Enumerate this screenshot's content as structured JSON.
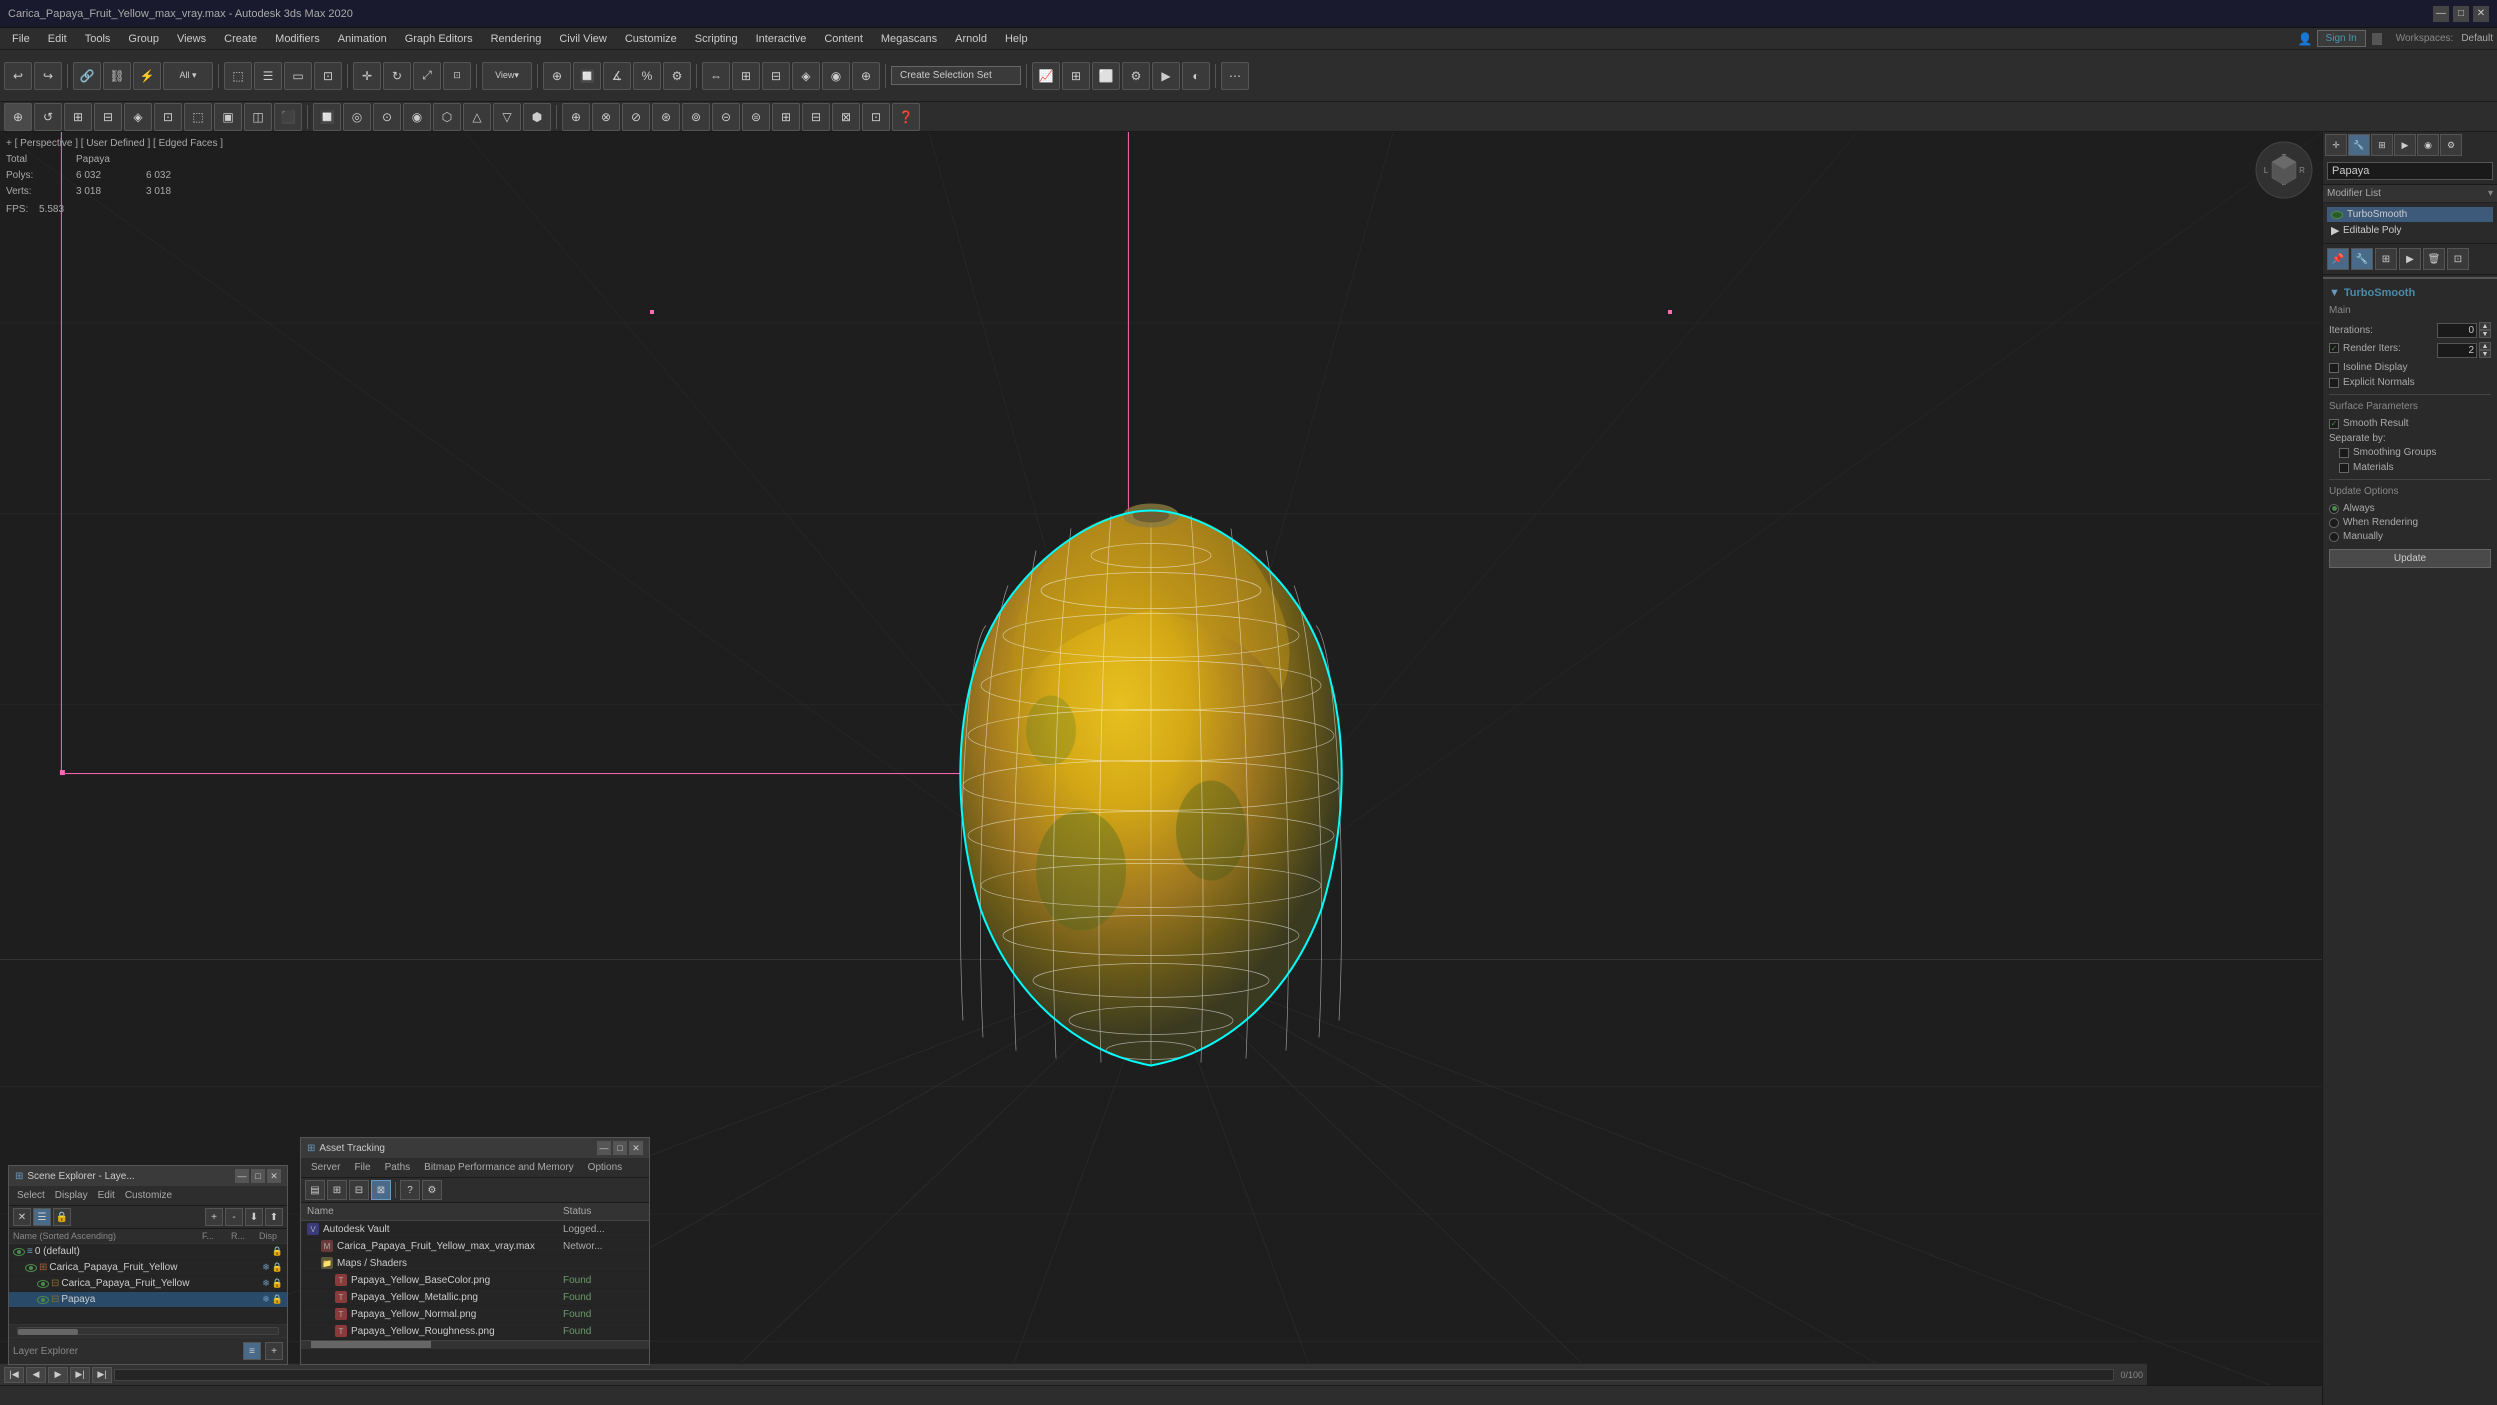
{
  "title": "Carica_Papaya_Fruit_Yellow_max_vray.max - Autodesk 3ds Max 2020",
  "titlebar": {
    "title": "Carica_Papaya_Fruit_Yellow_max_vray.max - Autodesk 3ds Max 2020",
    "min_btn": "—",
    "max_btn": "□",
    "close_btn": "✕"
  },
  "menubar": {
    "items": [
      "File",
      "Edit",
      "Tools",
      "Group",
      "Views",
      "Create",
      "Modifiers",
      "Animation",
      "Graph Editors",
      "Rendering",
      "Civil View",
      "Customize",
      "Scripting",
      "Interactive",
      "Content",
      "Megascans",
      "Arnold",
      "Help"
    ]
  },
  "toolbar": {
    "view_label": "View",
    "create_selection_set": "Create Selection Set",
    "all_label": "All"
  },
  "viewport": {
    "label": "+ [ Perspective ] [ User Defined ] [ Edged Faces ]",
    "stats_total_label": "Total",
    "stats_name": "Papaya",
    "polys_label": "Polys:",
    "polys_total": "6 032",
    "polys_value": "6 032",
    "verts_label": "Verts:",
    "verts_total": "3 018",
    "verts_value": "3 018",
    "fps_label": "FPS:",
    "fps_value": "5.583"
  },
  "right_panel": {
    "object_name": "Papaya",
    "tabs": [
      "create",
      "modify",
      "hierarchy",
      "motion",
      "display",
      "utilities"
    ],
    "modifier_list_label": "Modifier List",
    "modifiers": [
      {
        "name": "TurboSmooth",
        "active": true
      },
      {
        "name": "Editable Poly",
        "active": false
      }
    ],
    "turbosmooth": {
      "section_title": "TurboSmooth",
      "main_label": "Main",
      "iterations_label": "Iterations:",
      "iterations_value": "0",
      "render_iters_label": "Render Iters:",
      "render_iters_value": "2",
      "isoline_display": "Isoline Display",
      "explicit_normals": "Explicit Normals",
      "surface_parameters": "Surface Parameters",
      "smooth_result": "Smooth Result",
      "separate_by": "Separate by:",
      "materials": "Materials",
      "smoothing_groups": "Smoothing Groups",
      "update_options": "Update Options",
      "always": "Always",
      "when_rendering": "When Rendering",
      "manually": "Manually",
      "update_btn": "Update"
    },
    "icon_buttons": [
      "pin",
      "modify",
      "hierarchy",
      "motion",
      "display",
      "utilities"
    ]
  },
  "scene_explorer": {
    "title": "Scene Explorer - Laye...",
    "menu": [
      "Select",
      "Display",
      "Edit",
      "Customize"
    ],
    "columns": {
      "name": "Name (Sorted Ascending)",
      "f_col": "F...",
      "r_col": "R...",
      "disp_col": "Disp"
    },
    "items": [
      {
        "name": "0 (default)",
        "indent": 0,
        "type": "layer"
      },
      {
        "name": "Carica_Papaya_Fruit_Yellow",
        "indent": 1,
        "type": "group",
        "selected": false
      },
      {
        "name": "Carica_Papaya_Fruit_Yellow",
        "indent": 2,
        "type": "object"
      },
      {
        "name": "Papaya",
        "indent": 2,
        "type": "object",
        "selected": true
      }
    ],
    "footer_label": "Layer Explorer"
  },
  "asset_tracking": {
    "title": "Asset Tracking",
    "menu": [
      "Server",
      "File",
      "Paths",
      "Bitmap Performance and Memory",
      "Options"
    ],
    "toolbar_buttons": [
      "grid1",
      "grid2",
      "grid3",
      "grid4",
      "help",
      "settings"
    ],
    "columns": {
      "name": "Name",
      "status": "Status"
    },
    "items": [
      {
        "name": "Autodesk Vault",
        "status": "Logged...",
        "indent": 0,
        "type": "vault"
      },
      {
        "name": "Carica_Papaya_Fruit_Yellow_max_vray.max",
        "status": "Networ...",
        "indent": 1,
        "type": "file"
      },
      {
        "name": "Maps / Shaders",
        "status": "",
        "indent": 1,
        "type": "folder"
      },
      {
        "name": "Papaya_Yellow_BaseColor.png",
        "status": "Found",
        "indent": 2,
        "type": "file"
      },
      {
        "name": "Papaya_Yellow_Metallic.png",
        "status": "Found",
        "indent": 2,
        "type": "file"
      },
      {
        "name": "Papaya_Yellow_Normal.png",
        "status": "Found",
        "indent": 2,
        "type": "file"
      },
      {
        "name": "Papaya_Yellow_Roughness.png",
        "status": "Found",
        "indent": 2,
        "type": "file"
      }
    ]
  },
  "sign_in": {
    "label": "Sign In",
    "workspaces_label": "Workspaces:",
    "workspace_name": "Default"
  },
  "status_bar": {
    "text": ""
  }
}
